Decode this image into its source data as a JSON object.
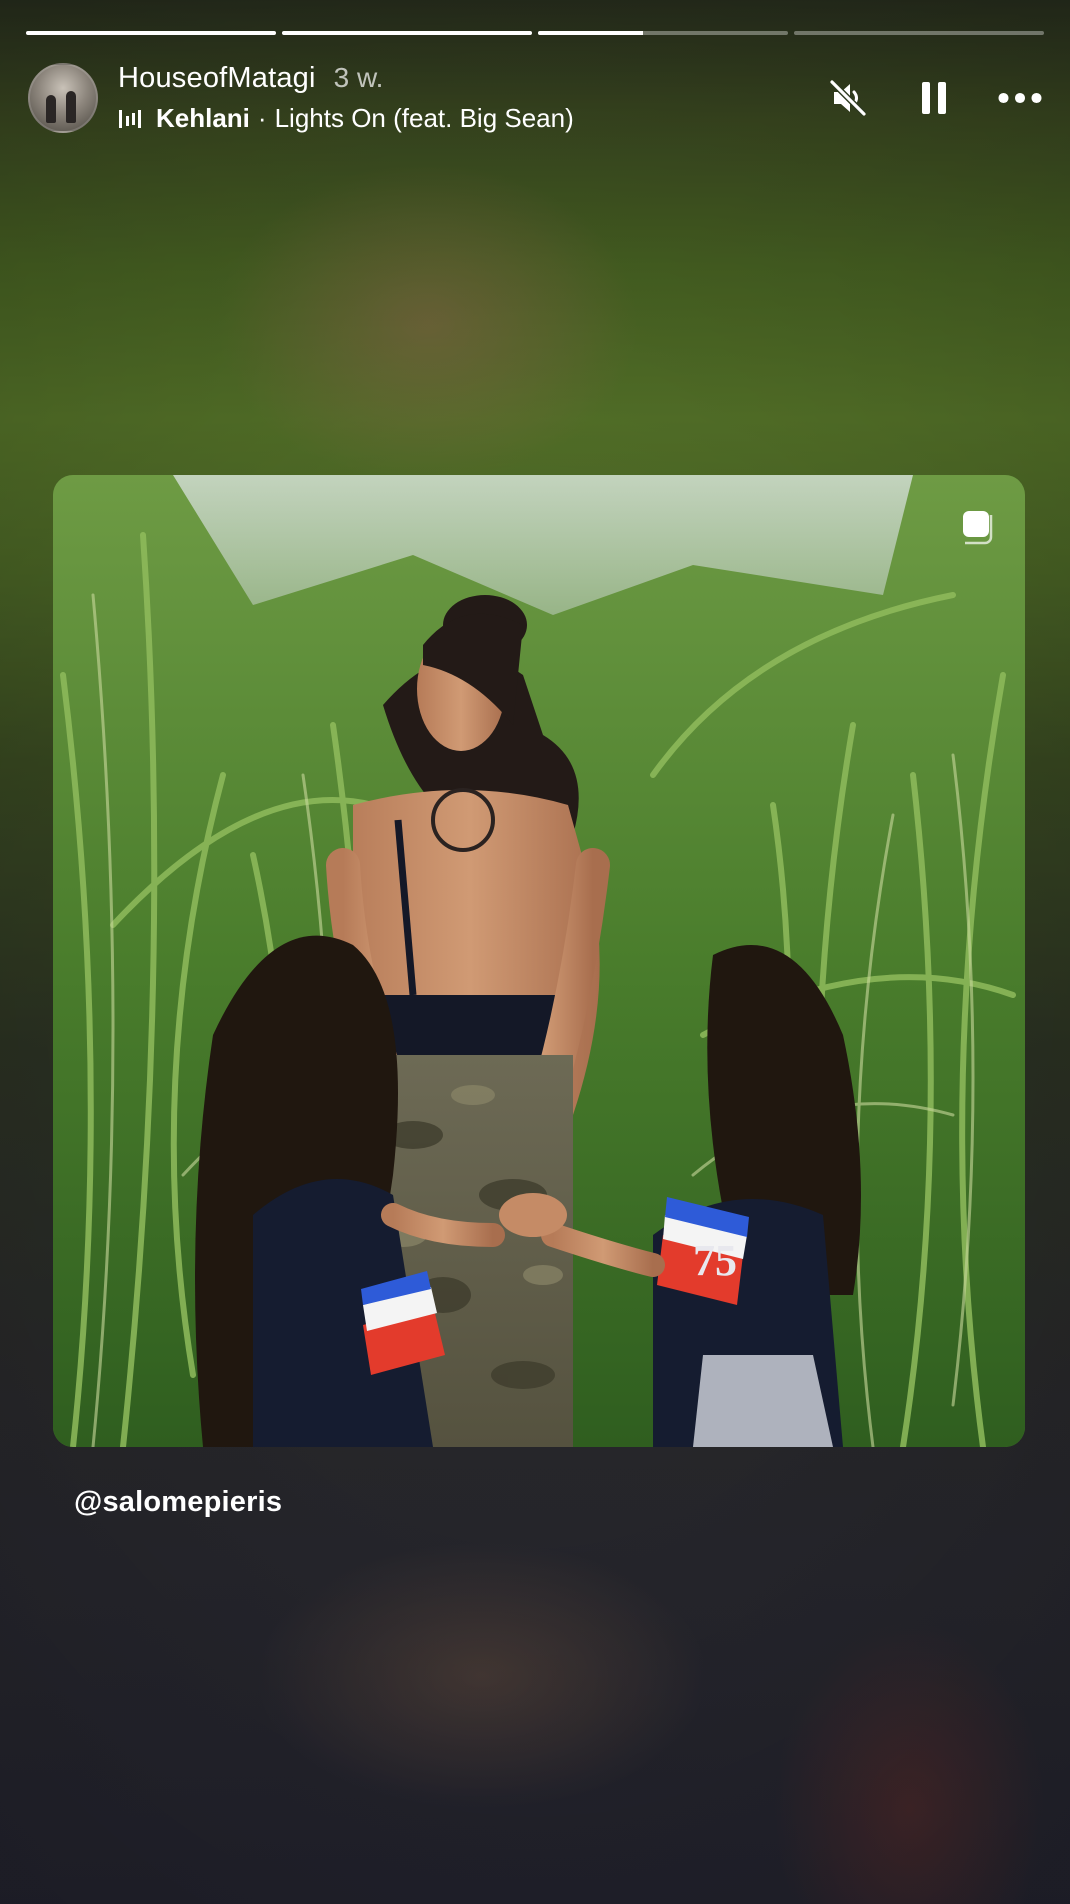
{
  "story": {
    "progress": [
      1,
      1,
      0.42,
      0
    ]
  },
  "header": {
    "username": "HouseofMatagi",
    "time": "3 w.",
    "music": {
      "icon": "music-bars-icon",
      "artist": "Kehlani",
      "separator": "·",
      "track": "Lights On (feat. Big Sean)"
    },
    "controls": [
      "mute-icon",
      "pause-icon",
      "more-icon"
    ]
  },
  "post": {
    "corner_icon": "instagram-post-icon",
    "credit": "@salomepieris",
    "jersey_number": "75"
  }
}
